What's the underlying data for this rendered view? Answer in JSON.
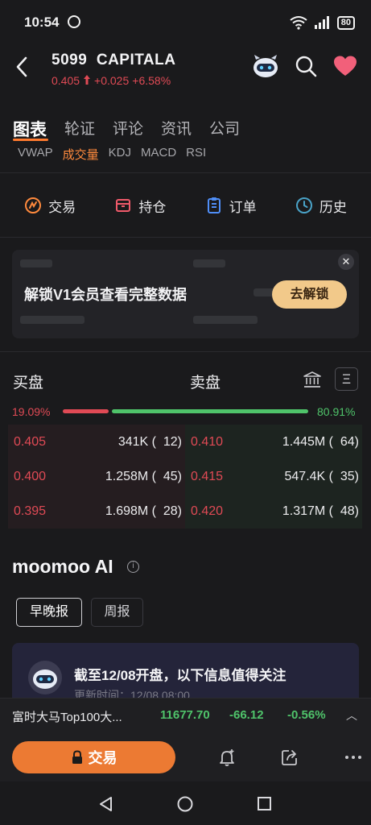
{
  "status": {
    "time": "10:54",
    "battery": "80"
  },
  "header": {
    "code": "5099",
    "name": "CAPITALA",
    "price": "0.405",
    "change": "+0.025",
    "change_pct": "+6.58%"
  },
  "tabs": [
    "图表",
    "轮证",
    "评论",
    "资讯",
    "公司"
  ],
  "subtabs": [
    "VWAP",
    "成交量",
    "KDJ",
    "MACD",
    "RSI"
  ],
  "actions": [
    {
      "label": "交易",
      "icon": "trade-icon"
    },
    {
      "label": "持仓",
      "icon": "position-icon"
    },
    {
      "label": "订单",
      "icon": "order-icon"
    },
    {
      "label": "历史",
      "icon": "history-icon"
    }
  ],
  "banner": {
    "text": "解锁V1会员查看完整数据",
    "button": "去解锁",
    "close": "✕"
  },
  "orderbook": {
    "bid_label": "买盘",
    "ask_label": "卖盘",
    "bid_pct": "19.09%",
    "ask_pct": "80.91%",
    "bid_ratio": 0.1909,
    "rows": [
      {
        "bid_price": "0.405",
        "bid_qty": "341K (  12)",
        "ask_price": "0.410",
        "ask_qty": "1.445M (  64)"
      },
      {
        "bid_price": "0.400",
        "bid_qty": "1.258M (  45)",
        "ask_price": "0.415",
        "ask_qty": "547.4K (  35)"
      },
      {
        "bid_price": "0.395",
        "bid_qty": "1.698M (  28)",
        "ask_price": "0.420",
        "ask_qty": "1.317M (  48)"
      }
    ],
    "menu_glyph": "Ξ"
  },
  "ai": {
    "title": "moomoo AI",
    "info": "i",
    "chips": [
      "早晚报",
      "周报"
    ],
    "card_title": "截至12/08开盘，以下信息值得关注",
    "card_sub": "更新时间：12/08 08:00"
  },
  "index": {
    "name": "富时大马Top100大...",
    "value": "11677.70",
    "change": "-66.12",
    "change_pct": "-0.56%"
  },
  "trade_bar": {
    "label": "交易"
  },
  "colors": {
    "up": "#e04a55",
    "down": "#4fc36a",
    "accent": "#ec7a33",
    "unlock": "#f2c98a"
  }
}
